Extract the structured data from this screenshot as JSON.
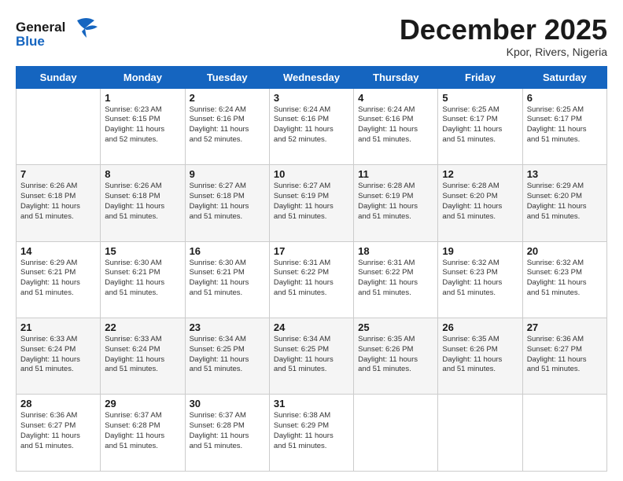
{
  "header": {
    "logo_line1": "General",
    "logo_line2": "Blue",
    "month": "December 2025",
    "location": "Kpor, Rivers, Nigeria"
  },
  "days_of_week": [
    "Sunday",
    "Monday",
    "Tuesday",
    "Wednesday",
    "Thursday",
    "Friday",
    "Saturday"
  ],
  "weeks": [
    [
      {
        "day": "",
        "info": ""
      },
      {
        "day": "1",
        "info": "Sunrise: 6:23 AM\nSunset: 6:15 PM\nDaylight: 11 hours\nand 52 minutes."
      },
      {
        "day": "2",
        "info": "Sunrise: 6:24 AM\nSunset: 6:16 PM\nDaylight: 11 hours\nand 52 minutes."
      },
      {
        "day": "3",
        "info": "Sunrise: 6:24 AM\nSunset: 6:16 PM\nDaylight: 11 hours\nand 52 minutes."
      },
      {
        "day": "4",
        "info": "Sunrise: 6:24 AM\nSunset: 6:16 PM\nDaylight: 11 hours\nand 51 minutes."
      },
      {
        "day": "5",
        "info": "Sunrise: 6:25 AM\nSunset: 6:17 PM\nDaylight: 11 hours\nand 51 minutes."
      },
      {
        "day": "6",
        "info": "Sunrise: 6:25 AM\nSunset: 6:17 PM\nDaylight: 11 hours\nand 51 minutes."
      }
    ],
    [
      {
        "day": "7",
        "info": "Sunrise: 6:26 AM\nSunset: 6:18 PM\nDaylight: 11 hours\nand 51 minutes."
      },
      {
        "day": "8",
        "info": "Sunrise: 6:26 AM\nSunset: 6:18 PM\nDaylight: 11 hours\nand 51 minutes."
      },
      {
        "day": "9",
        "info": "Sunrise: 6:27 AM\nSunset: 6:18 PM\nDaylight: 11 hours\nand 51 minutes."
      },
      {
        "day": "10",
        "info": "Sunrise: 6:27 AM\nSunset: 6:19 PM\nDaylight: 11 hours\nand 51 minutes."
      },
      {
        "day": "11",
        "info": "Sunrise: 6:28 AM\nSunset: 6:19 PM\nDaylight: 11 hours\nand 51 minutes."
      },
      {
        "day": "12",
        "info": "Sunrise: 6:28 AM\nSunset: 6:20 PM\nDaylight: 11 hours\nand 51 minutes."
      },
      {
        "day": "13",
        "info": "Sunrise: 6:29 AM\nSunset: 6:20 PM\nDaylight: 11 hours\nand 51 minutes."
      }
    ],
    [
      {
        "day": "14",
        "info": "Sunrise: 6:29 AM\nSunset: 6:21 PM\nDaylight: 11 hours\nand 51 minutes."
      },
      {
        "day": "15",
        "info": "Sunrise: 6:30 AM\nSunset: 6:21 PM\nDaylight: 11 hours\nand 51 minutes."
      },
      {
        "day": "16",
        "info": "Sunrise: 6:30 AM\nSunset: 6:21 PM\nDaylight: 11 hours\nand 51 minutes."
      },
      {
        "day": "17",
        "info": "Sunrise: 6:31 AM\nSunset: 6:22 PM\nDaylight: 11 hours\nand 51 minutes."
      },
      {
        "day": "18",
        "info": "Sunrise: 6:31 AM\nSunset: 6:22 PM\nDaylight: 11 hours\nand 51 minutes."
      },
      {
        "day": "19",
        "info": "Sunrise: 6:32 AM\nSunset: 6:23 PM\nDaylight: 11 hours\nand 51 minutes."
      },
      {
        "day": "20",
        "info": "Sunrise: 6:32 AM\nSunset: 6:23 PM\nDaylight: 11 hours\nand 51 minutes."
      }
    ],
    [
      {
        "day": "21",
        "info": "Sunrise: 6:33 AM\nSunset: 6:24 PM\nDaylight: 11 hours\nand 51 minutes."
      },
      {
        "day": "22",
        "info": "Sunrise: 6:33 AM\nSunset: 6:24 PM\nDaylight: 11 hours\nand 51 minutes."
      },
      {
        "day": "23",
        "info": "Sunrise: 6:34 AM\nSunset: 6:25 PM\nDaylight: 11 hours\nand 51 minutes."
      },
      {
        "day": "24",
        "info": "Sunrise: 6:34 AM\nSunset: 6:25 PM\nDaylight: 11 hours\nand 51 minutes."
      },
      {
        "day": "25",
        "info": "Sunrise: 6:35 AM\nSunset: 6:26 PM\nDaylight: 11 hours\nand 51 minutes."
      },
      {
        "day": "26",
        "info": "Sunrise: 6:35 AM\nSunset: 6:26 PM\nDaylight: 11 hours\nand 51 minutes."
      },
      {
        "day": "27",
        "info": "Sunrise: 6:36 AM\nSunset: 6:27 PM\nDaylight: 11 hours\nand 51 minutes."
      }
    ],
    [
      {
        "day": "28",
        "info": "Sunrise: 6:36 AM\nSunset: 6:27 PM\nDaylight: 11 hours\nand 51 minutes."
      },
      {
        "day": "29",
        "info": "Sunrise: 6:37 AM\nSunset: 6:28 PM\nDaylight: 11 hours\nand 51 minutes."
      },
      {
        "day": "30",
        "info": "Sunrise: 6:37 AM\nSunset: 6:28 PM\nDaylight: 11 hours\nand 51 minutes."
      },
      {
        "day": "31",
        "info": "Sunrise: 6:38 AM\nSunset: 6:29 PM\nDaylight: 11 hours\nand 51 minutes."
      },
      {
        "day": "",
        "info": ""
      },
      {
        "day": "",
        "info": ""
      },
      {
        "day": "",
        "info": ""
      }
    ]
  ]
}
